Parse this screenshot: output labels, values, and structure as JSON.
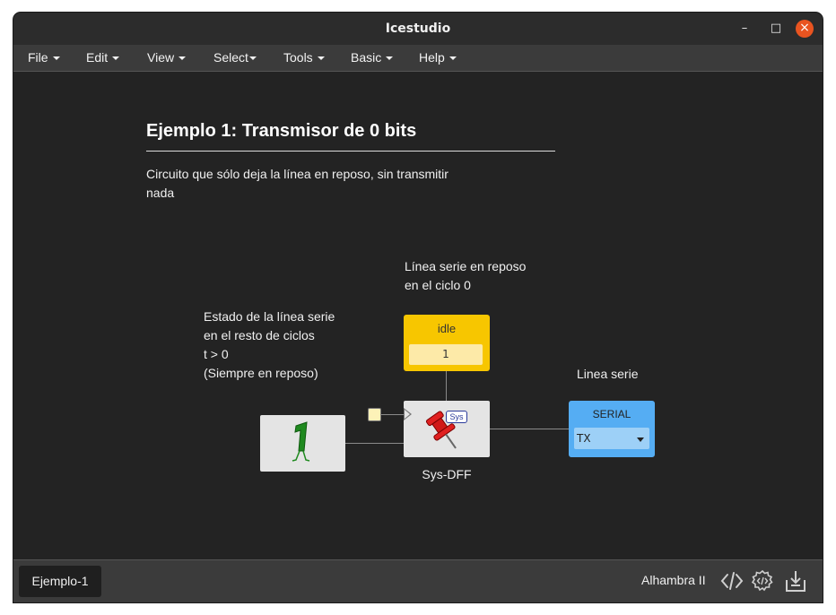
{
  "window": {
    "title": "Icestudio"
  },
  "menu": [
    {
      "label": "File"
    },
    {
      "label": "Edit"
    },
    {
      "label": "View"
    },
    {
      "label": "Select"
    },
    {
      "label": "Tools"
    },
    {
      "label": "Basic"
    },
    {
      "label": "Help"
    }
  ],
  "canvas": {
    "heading": "Ejemplo 1: Transmisor de 0 bits",
    "description": [
      "Circuito que sólo deja la línea en reposo, sin transmitir",
      "nada"
    ],
    "note_idle": [
      "Línea serie en reposo",
      "en el ciclo 0"
    ],
    "note_state": [
      "Estado de la línea serie",
      "en el resto de ciclos",
      "t > 0",
      "(Siempre en reposo)"
    ],
    "note_serial": "Linea serie",
    "idle_block": {
      "label": "idle",
      "value": "1"
    },
    "dff_block": {
      "name": "Sys-DFF",
      "badge": "Sys"
    },
    "serial_block": {
      "label": "SERIAL",
      "selected": "TX"
    },
    "colors": {
      "idle": "#f7c600",
      "serial": "#55adf3",
      "block": "#e4e4e4",
      "const_glyph": "#1f8a1f"
    }
  },
  "status": {
    "tab": "Ejemplo-1",
    "board": "Alhambra II"
  },
  "icons": [
    "code-icon",
    "gear-code-icon",
    "upload-icon"
  ]
}
